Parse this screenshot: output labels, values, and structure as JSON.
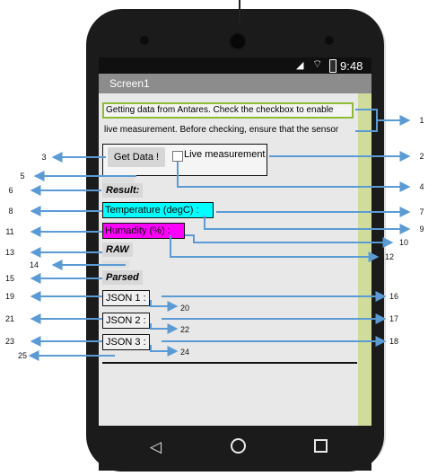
{
  "statusbar": {
    "time": "9:48",
    "wifi_icon": "wifi-icon",
    "battery_icon": "battery-icon",
    "signal_icon": "signal-icon"
  },
  "titlebar": {
    "title": "Screen1"
  },
  "content": {
    "info_line1": "Getting data from Antares. Check the checkbox to enable",
    "info_line2": "live measurement. Before checking, ensure that the sensor",
    "get_data_label": "Get Data !",
    "live_measurement_label": "Live measurement",
    "live_measurement_checked": false,
    "result_label": "Result:",
    "temperature_label": "Temperature (degC) :",
    "humidity_label": "Humadity (%) :",
    "raw_label": "RAW",
    "parsed_label": "Parsed",
    "json1_label": "JSON 1 :",
    "json2_label": "JSON 2 :",
    "json3_label": "JSON 3 :"
  },
  "navigation": {
    "back_icon": "back-triangle-icon",
    "home_icon": "home-circle-icon",
    "recent_icon": "recent-square-icon"
  },
  "annotations": {
    "numbers": [
      "1",
      "2",
      "3",
      "4",
      "5",
      "6",
      "7",
      "8",
      "9",
      "10",
      "11",
      "12",
      "13",
      "14",
      "15",
      "16",
      "17",
      "18",
      "19",
      "20",
      "21",
      "22",
      "23",
      "24",
      "25"
    ]
  },
  "colors": {
    "temperature_bg": "#00ffff",
    "humidity_bg": "#ff00ff",
    "arrow": "#5b9bd5",
    "label_border_green": "#8cbb35"
  }
}
